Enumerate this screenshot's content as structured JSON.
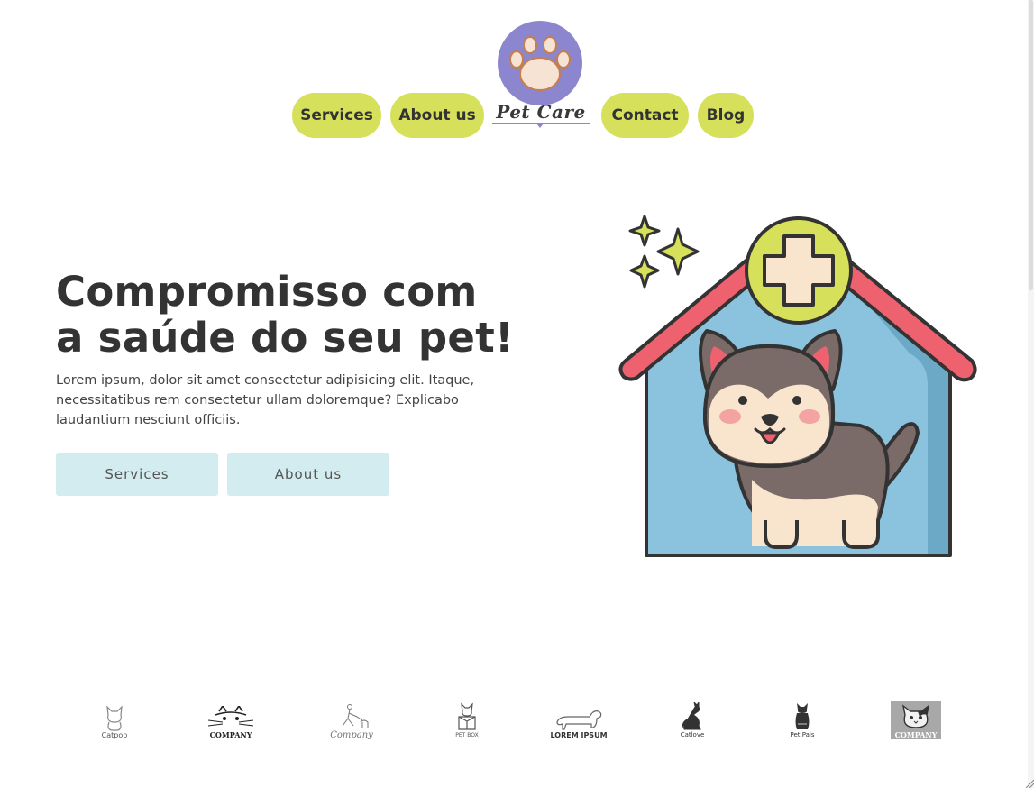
{
  "nav": {
    "left": [
      {
        "label": "Services"
      },
      {
        "label": "About us"
      }
    ],
    "right": [
      {
        "label": "Contact"
      },
      {
        "label": "Blog"
      }
    ],
    "logo_text": "Pet Care"
  },
  "hero": {
    "title_line1": "Compromisso com",
    "title_line2": "a saúde do seu pet!",
    "description": "Lorem ipsum, dolor sit amet consectetur adipisicing elit. Itaque, necessitatibus rem consectetur ullam doloremque? Explicabo laudantium nesciunt officiis.",
    "buttons": [
      {
        "label": "Services"
      },
      {
        "label": "About us"
      }
    ]
  },
  "brands": [
    {
      "name": "Catpop"
    },
    {
      "name": "COMPANY"
    },
    {
      "name": "Company"
    },
    {
      "name": "PET BOX"
    },
    {
      "name": "LOREM IPSUM"
    },
    {
      "name": "Catlove"
    },
    {
      "name": "Pet Pals"
    },
    {
      "name": "COMPANY"
    }
  ],
  "colors": {
    "nav_button": "#d6e05a",
    "logo_circle": "#8c86cf",
    "hero_button": "#d3ecf0",
    "roof": "#ee6270",
    "house": "#8bc3de",
    "cross_badge": "#d6e05a"
  }
}
